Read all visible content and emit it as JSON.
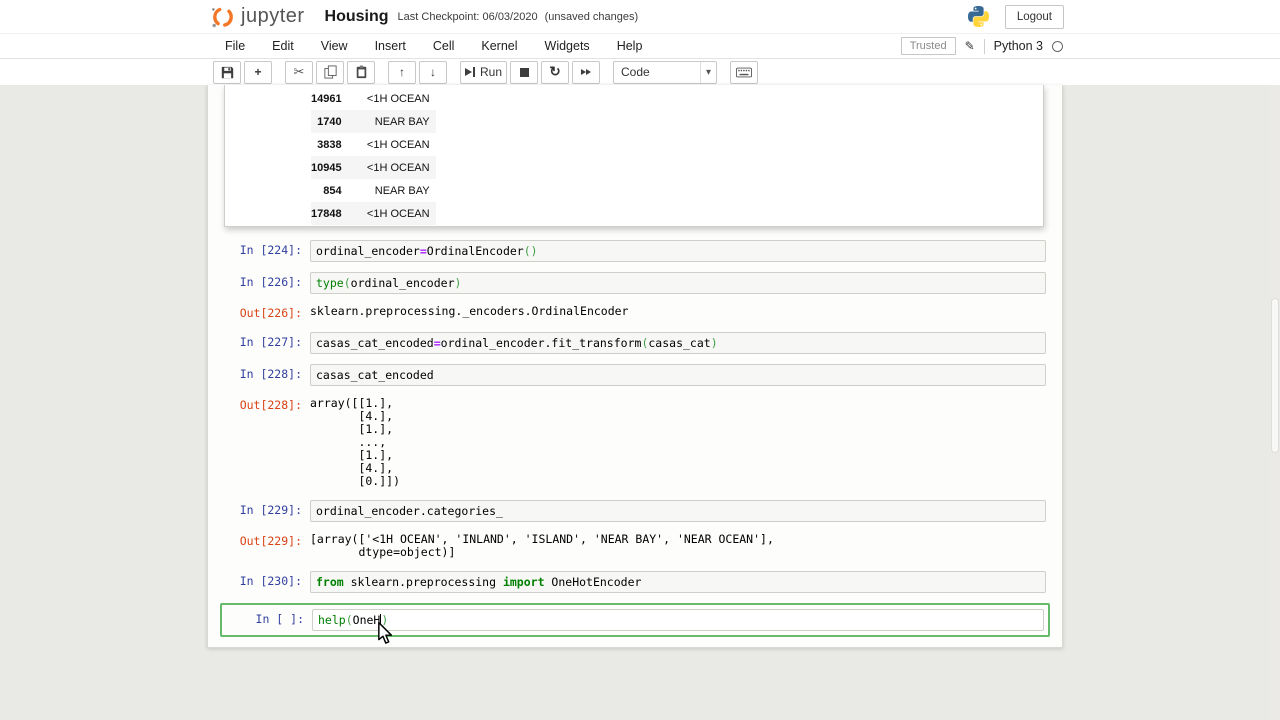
{
  "colors": {
    "prompt_in": "#303F9F",
    "prompt_out": "#D84315",
    "keyword_green": "#008000",
    "operator_purple": "#AA22FF",
    "paren_green": "#43A047",
    "active_cell_border": "#66BB6A",
    "brand_orange": "#F37726",
    "python_blue": "#366994",
    "python_yellow": "#FFD43B",
    "page_background": "#e9e9e6"
  },
  "header": {
    "brand": "jupyter",
    "title": "Housing",
    "checkpoint": "Last Checkpoint: 06/03/2020",
    "unsaved": "(unsaved changes)",
    "logout": "Logout"
  },
  "menu": {
    "items": [
      "File",
      "Edit",
      "View",
      "Insert",
      "Cell",
      "Kernel",
      "Widgets",
      "Help"
    ],
    "trusted": "Trusted",
    "kernel_name": "Python 3"
  },
  "toolbar": {
    "run_label": "Run",
    "cell_type": "Code",
    "icons": {
      "save": "floppy-disk",
      "add_cell": "+",
      "cut": "✂",
      "copy": "two-pages",
      "paste": "clipboard",
      "move_up": "↑",
      "move_down": "↓",
      "run": "step-forward",
      "stop": "square",
      "restart": "↻",
      "restart_run_all": "fast-forward",
      "celltype_caret": "▾",
      "command_palette": "keyboard",
      "edit_pencil": "✎",
      "kernel_idle": "circle"
    }
  },
  "scrolled_output": {
    "rows": [
      {
        "index": "14961",
        "value": "<1H OCEAN"
      },
      {
        "index": "1740",
        "value": "NEAR BAY"
      },
      {
        "index": "3838",
        "value": "<1H OCEAN"
      },
      {
        "index": "10945",
        "value": "<1H OCEAN"
      },
      {
        "index": "854",
        "value": "NEAR BAY"
      },
      {
        "index": "17848",
        "value": "<1H OCEAN"
      }
    ]
  },
  "cells": {
    "c224": {
      "prompt": "In [224]:",
      "tokens": [
        {
          "t": "ordinal_encoder"
        },
        {
          "t": "=",
          "c": "op"
        },
        {
          "t": "OrdinalEncoder"
        },
        {
          "t": "()",
          "c": "paren"
        }
      ]
    },
    "c226": {
      "prompt": "In [226]:",
      "tokens": [
        {
          "t": "type",
          "c": "builtin"
        },
        {
          "t": "(",
          "c": "paren"
        },
        {
          "t": "ordinal_encoder"
        },
        {
          "t": ")",
          "c": "paren"
        }
      ]
    },
    "o226": {
      "prompt": "Out[226]:",
      "lines": [
        "sklearn.preprocessing._encoders.OrdinalEncoder"
      ]
    },
    "c227": {
      "prompt": "In [227]:",
      "tokens": [
        {
          "t": "casas_cat_encoded"
        },
        {
          "t": "=",
          "c": "op"
        },
        {
          "t": "ordinal_encoder.fit_transform"
        },
        {
          "t": "(",
          "c": "paren"
        },
        {
          "t": "casas_cat"
        },
        {
          "t": ")",
          "c": "paren"
        }
      ]
    },
    "c228": {
      "prompt": "In [228]:",
      "tokens": [
        {
          "t": "casas_cat_encoded"
        }
      ]
    },
    "o228": {
      "prompt": "Out[228]:",
      "lines": [
        "array([[1.],",
        "       [4.],",
        "       [1.],",
        "       ...,",
        "       [1.],",
        "       [4.],",
        "       [0.]])"
      ]
    },
    "c229": {
      "prompt": "In [229]:",
      "tokens": [
        {
          "t": "ordinal_encoder.categories_"
        }
      ]
    },
    "o229": {
      "prompt": "Out[229]:",
      "lines": [
        "[array(['<1H OCEAN', 'INLAND', 'ISLAND', 'NEAR BAY', 'NEAR OCEAN'],",
        "       dtype=object)]"
      ]
    },
    "c230": {
      "prompt": "In [230]:",
      "tokens": [
        {
          "t": "from",
          "c": "kw"
        },
        {
          "t": " sklearn.preprocessing "
        },
        {
          "t": "import",
          "c": "kw"
        },
        {
          "t": " OneHotEncoder"
        }
      ]
    },
    "active": {
      "prompt": "In [ ]:",
      "tokens": [
        {
          "t": "help",
          "c": "builtin"
        },
        {
          "t": "(",
          "c": "paren"
        },
        {
          "t": "OneH"
        },
        {
          "t": "",
          "c": "cursor"
        },
        {
          "t": ")",
          "c": "paren"
        }
      ]
    }
  }
}
